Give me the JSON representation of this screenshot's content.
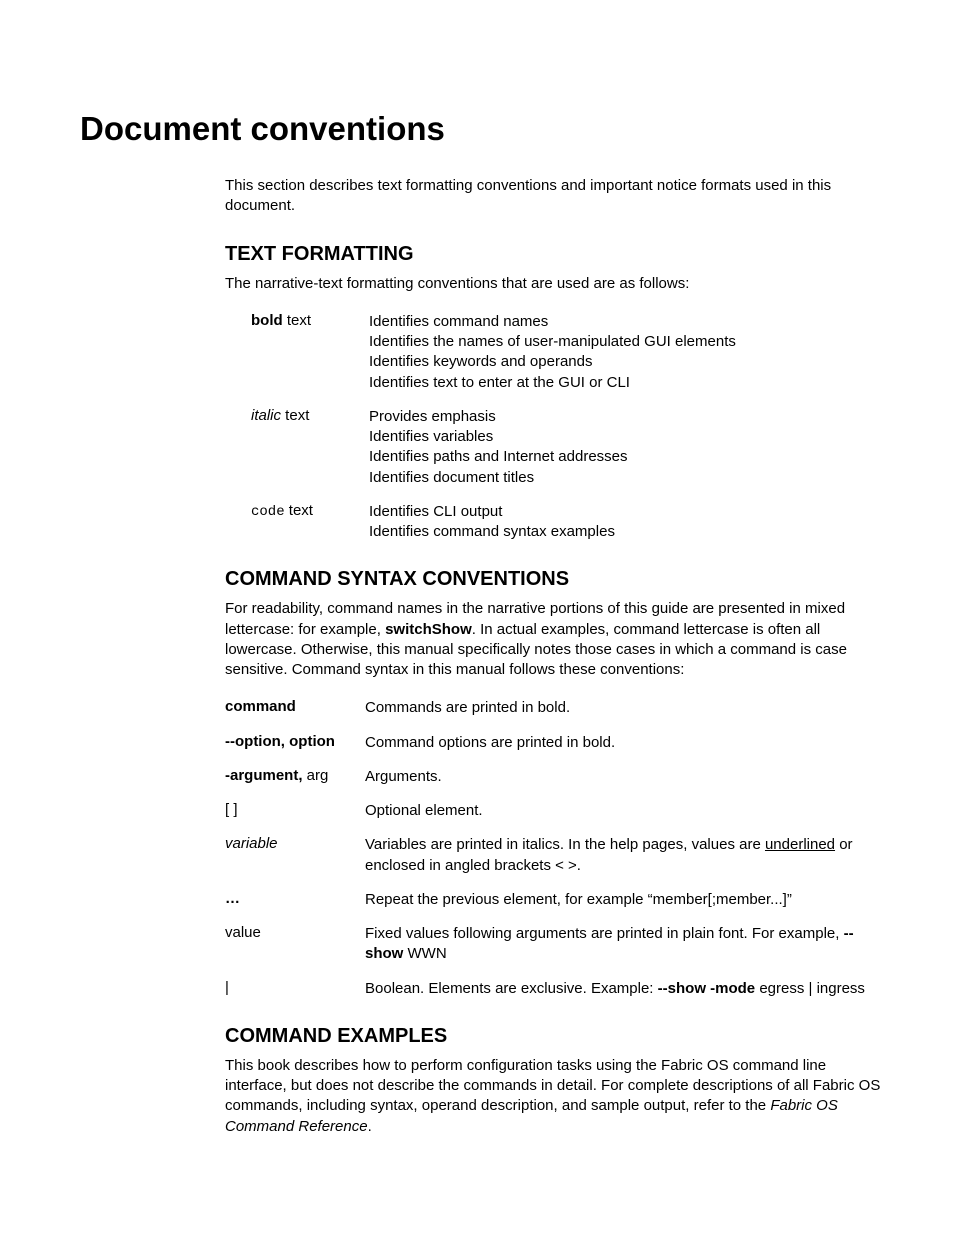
{
  "title": "Document conventions",
  "intro": "This section describes text formatting conventions and important notice formats used in this document.",
  "sec1": {
    "heading": "TEXT FORMATTING",
    "intro": "The narrative-text formatting conventions that are used are as follows:",
    "rows": [
      {
        "k_bold": "bold",
        "k_tail": " text",
        "lines": [
          "Identifies command names",
          "Identifies the names of user-manipulated GUI elements",
          "Identifies keywords and operands",
          "Identifies text to enter at the GUI or CLI"
        ]
      },
      {
        "k_italic": "italic",
        "k_tail": " text",
        "lines": [
          "Provides emphasis",
          "Identifies variables",
          "Identifies paths and Internet addresses",
          "Identifies document titles"
        ]
      },
      {
        "k_code": "code",
        "k_tail": " text",
        "lines": [
          "Identifies CLI output",
          "Identifies command syntax examples"
        ]
      }
    ]
  },
  "sec2": {
    "heading": "COMMAND SYNTAX CONVENTIONS",
    "intro_a": "For readability, command names in the narrative portions of this guide are presented in mixed lettercase: for example, ",
    "intro_bold": "switchShow",
    "intro_b": ". In actual examples, command lettercase is often all lowercase. Otherwise, this manual specifically notes those cases in which a command is case sensitive. Command syntax in this manual follows these conventions:",
    "rows": {
      "r1": {
        "k": "command",
        "v": "Commands are printed in bold."
      },
      "r2": {
        "k": "--option, option",
        "v": "Command options are printed in bold."
      },
      "r3": {
        "kb": "-argument,",
        "kt": " arg",
        "v": "Arguments."
      },
      "r4": {
        "k": "[ ]",
        "v": "Optional element."
      },
      "r5": {
        "k": "variable",
        "va": "Variables are printed in italics. In the help pages, values are ",
        "vu": "underlined",
        "vb": " or enclosed in angled brackets < >."
      },
      "r6": {
        "k": "…",
        "v": "Repeat the previous element, for example “member[;member...]”"
      },
      "r7": {
        "k": "value",
        "va": "Fixed values following arguments are printed in plain font. For example, ",
        "vb": "--show",
        "vc": " WWN"
      },
      "r8": {
        "k": "|",
        "va": "Boolean. Elements are exclusive. Example: ",
        "vb": "--show -mode",
        "vc": " egress | ingress"
      }
    }
  },
  "sec3": {
    "heading": "COMMAND EXAMPLES",
    "pa": "This book describes how to perform configuration tasks using the Fabric OS command line interface, but does not describe the commands in detail. For complete descriptions of all Fabric OS commands, including syntax, operand description, and sample output, refer to the ",
    "pi": "Fabric OS Command Reference",
    "pb": "."
  }
}
